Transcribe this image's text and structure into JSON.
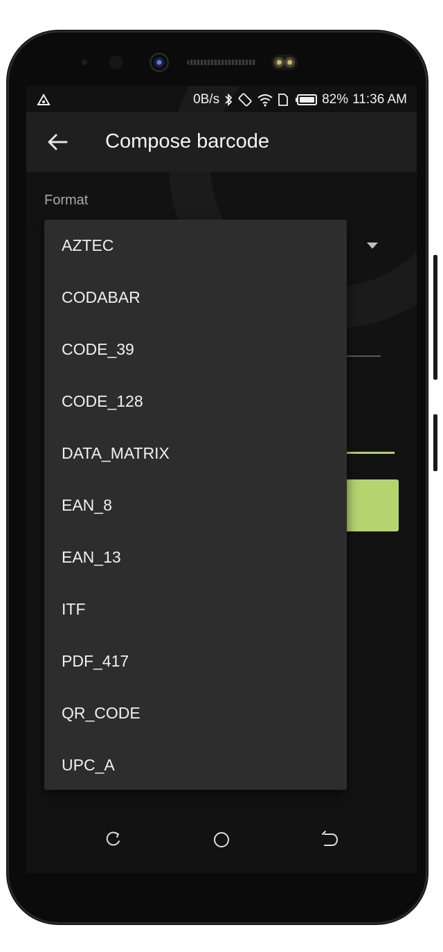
{
  "status_bar": {
    "network_speed": "0B/s",
    "battery_percent": "82%",
    "time": "11:36 AM",
    "icons": [
      "notification-triangle-icon",
      "bluetooth-icon",
      "auto-rotate-icon",
      "wifi-icon",
      "sim-icon",
      "battery-icon"
    ]
  },
  "app_bar": {
    "back_icon": "arrow-left-icon",
    "title": "Compose barcode"
  },
  "form": {
    "format_label": "Format"
  },
  "dropdown": {
    "options": [
      "AZTEC",
      "CODABAR",
      "CODE_39",
      "CODE_128",
      "DATA_MATRIX",
      "EAN_8",
      "EAN_13",
      "ITF",
      "PDF_417",
      "QR_CODE",
      "UPC_A"
    ]
  },
  "nav_bar": {
    "icons": [
      "recent-apps-icon",
      "home-icon",
      "back-icon"
    ]
  },
  "colors": {
    "accent": "#b5d46f",
    "background": "#121212",
    "menu_background": "#2d2d2d",
    "app_bar": "#1f1f1f"
  }
}
